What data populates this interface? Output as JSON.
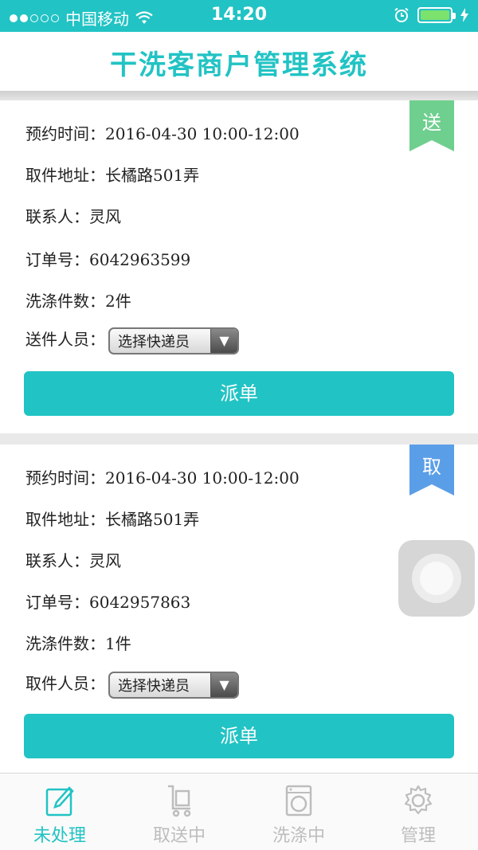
{
  "status_bar": {
    "carrier": "中国移动",
    "time": "14:20"
  },
  "header": {
    "title": "干洗客商户管理系统"
  },
  "colors": {
    "accent": "#22c3c4",
    "ribbon_deliver": "#6fcf8e",
    "ribbon_pickup": "#5b9ee8"
  },
  "orders": [
    {
      "ribbon": "送",
      "time_label": "预约时间：",
      "time_value": "2016-04-30 10:00-12:00",
      "address_label": "取件地址：",
      "address_value": "长橘路501弄",
      "contact_label": "联系人：",
      "contact_value": "灵风",
      "order_label": "订单号：",
      "order_value": "6042963599",
      "count_label": "洗涤件数：",
      "count_value": "2件",
      "staff_label": "送件人员：",
      "staff_select": "选择快递员",
      "button": "派单"
    },
    {
      "ribbon": "取",
      "time_label": "预约时间：",
      "time_value": "2016-04-30 10:00-12:00",
      "address_label": "取件地址：",
      "address_value": "长橘路501弄",
      "contact_label": "联系人：",
      "contact_value": "灵风",
      "order_label": "订单号：",
      "order_value": "6042957863",
      "count_label": "洗涤件数：",
      "count_value": "1件",
      "staff_label": "取件人员：",
      "staff_select": "选择快递员",
      "button": "派单"
    }
  ],
  "tabs": [
    {
      "label": "未处理",
      "icon": "edit-icon",
      "active": true
    },
    {
      "label": "取送中",
      "icon": "cart-icon",
      "active": false
    },
    {
      "label": "洗涤中",
      "icon": "washer-icon",
      "active": false
    },
    {
      "label": "管理",
      "icon": "gear-icon",
      "active": false
    }
  ]
}
